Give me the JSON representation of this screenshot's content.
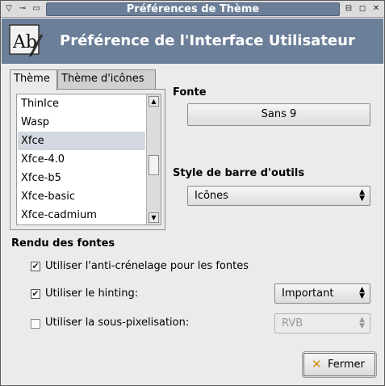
{
  "window": {
    "title": "Préférences de Thème",
    "header_title": "Préférence de l'Interface Utilisateur"
  },
  "titlebar_icons": {
    "menu": "menu-arrow-icon",
    "stick": "pin-icon",
    "shade": "shade-icon",
    "minimize": "minimize-icon",
    "maximize": "maximize-icon",
    "close": "close-icon"
  },
  "tabs": [
    {
      "label": "Thème",
      "active": true
    },
    {
      "label": "Thème d'icônes",
      "active": false
    }
  ],
  "theme_list": {
    "items": [
      "ThinIce",
      "Wasp",
      "Xfce",
      "Xfce-4.0",
      "Xfce-b5",
      "Xfce-basic",
      "Xfce-cadmium"
    ],
    "selected": "Xfce"
  },
  "font": {
    "label": "Fonte",
    "value": "Sans 9"
  },
  "toolbar_style": {
    "label": "Style de barre d'outils",
    "value": "Icônes"
  },
  "font_rendering": {
    "label": "Rendu des fontes",
    "antialias": {
      "label": "Utiliser l'anti-crénelage pour les fontes",
      "checked": true
    },
    "hinting": {
      "label": "Utiliser le hinting:",
      "checked": true,
      "value": "Important"
    },
    "subpixel": {
      "label": "Utiliser la sous-pixelisation:",
      "checked": false,
      "value": "RVB"
    }
  },
  "close_button": {
    "label": "Fermer"
  },
  "colors": {
    "titlebar_accent": "#6c7f99",
    "selection": "#d4d8e0"
  }
}
